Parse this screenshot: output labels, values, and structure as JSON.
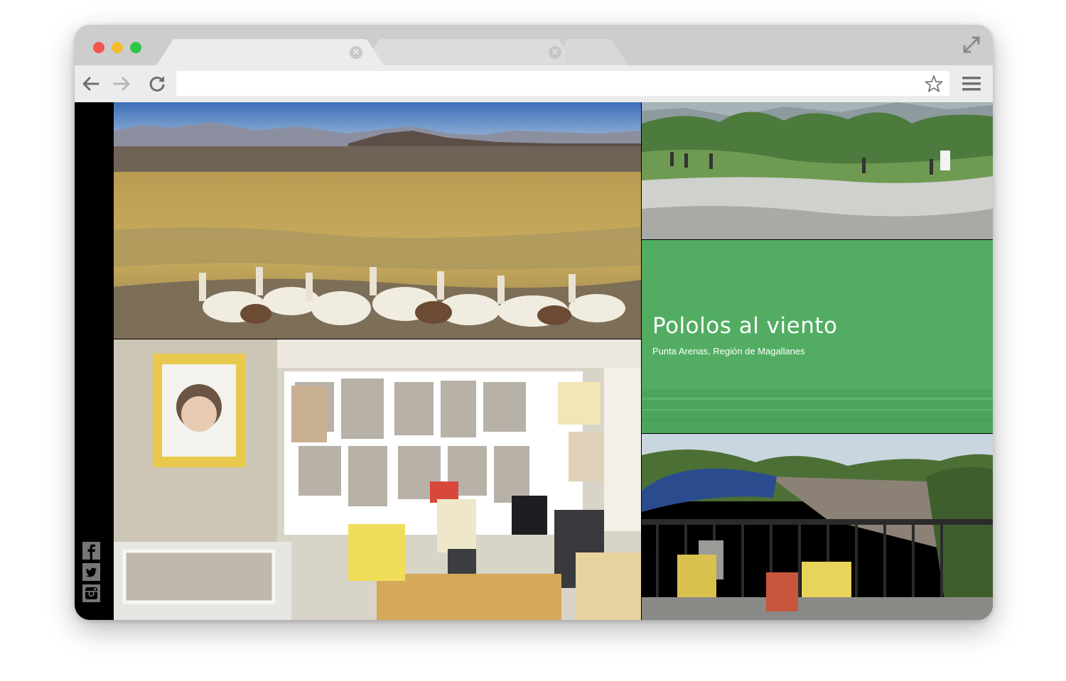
{
  "browser": {
    "tabs": [
      {
        "label": "",
        "active": true
      },
      {
        "label": "",
        "active": false
      },
      {
        "label": "",
        "active": false
      }
    ],
    "address_bar": {
      "value": "",
      "placeholder": ""
    },
    "icons": {
      "back": "arrow-left-icon",
      "forward": "arrow-right-icon",
      "reload": "reload-icon",
      "bookmark": "star-icon",
      "menu": "hamburger-menu-icon",
      "fullscreen": "expand-icon"
    }
  },
  "page": {
    "feature": {
      "title": "Pololos al viento",
      "subtitle": "Punta Arenas, Región de Magallanes",
      "background_color": "#52ad62"
    },
    "tiles": [
      {
        "subject": "llamas grazing on the altiplano"
      },
      {
        "subject": "roadside shrine with newspaper clippings"
      },
      {
        "subject": "people walking along a river"
      },
      {
        "subject": "umbrella and chairs on a riverside bridge"
      }
    ],
    "social_links": [
      {
        "icon": "facebook-icon"
      },
      {
        "icon": "twitter-icon"
      },
      {
        "icon": "instagram-icon"
      }
    ]
  },
  "colors": {
    "frame": "#cdcdcd",
    "toolbar": "#ececec",
    "feature_green": "#52ad62",
    "traffic_red": "#f0554f",
    "traffic_yellow": "#f4bc2e",
    "traffic_green": "#2dc64a"
  }
}
